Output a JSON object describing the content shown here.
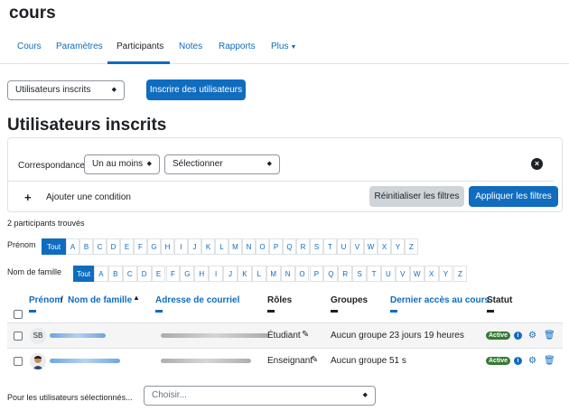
{
  "page": {
    "course_title": "cours"
  },
  "tabs": [
    {
      "label": "Cours"
    },
    {
      "label": "Paramètres"
    },
    {
      "label": "Participants"
    },
    {
      "label": "Notes"
    },
    {
      "label": "Rapports"
    },
    {
      "label": "Plus"
    }
  ],
  "enrol_select": {
    "value": "Utilisateurs inscrits"
  },
  "enrol_button": {
    "label": "Inscrire des utilisateurs"
  },
  "heading": "Utilisateurs inscrits",
  "filter": {
    "match_label": "Correspondance",
    "match_value": "Un au moins",
    "type_value": "Sélectionner",
    "add_condition": "Ajouter une condition",
    "reset": "Réinitialiser les filtres",
    "apply": "Appliquer les filtres"
  },
  "count_text": "2 participants trouvés",
  "firstname_filter": {
    "label": "Prénom",
    "all": "Tout"
  },
  "lastname_filter": {
    "label": "Nom de famille",
    "all": "Tout"
  },
  "letters": [
    "A",
    "B",
    "C",
    "D",
    "E",
    "F",
    "G",
    "H",
    "I",
    "J",
    "K",
    "L",
    "M",
    "N",
    "O",
    "P",
    "Q",
    "R",
    "S",
    "T",
    "U",
    "V",
    "W",
    "X",
    "Y",
    "Z"
  ],
  "table": {
    "headers": {
      "firstname": "Prénom",
      "separator": "/",
      "lastname": "Nom de famille",
      "email": "Adresse de courriel",
      "roles": "Rôles",
      "groups": "Groupes",
      "last_access": "Dernier accès au cours",
      "status": "Statut"
    },
    "rows": [
      {
        "initials": "SB",
        "role": "Étudiant",
        "group": "Aucun groupe",
        "last_access": "23 jours 19 heures",
        "status": "Active"
      },
      {
        "initials": "",
        "role": "Enseignant",
        "group": "Aucun groupe",
        "last_access": "51 s",
        "status": "Active"
      }
    ]
  },
  "bulk": {
    "label": "Pour les utilisateurs sélectionnés...",
    "placeholder": "Choisir..."
  },
  "colors": {
    "primary": "#0f6cbf",
    "success": "#357a32"
  }
}
